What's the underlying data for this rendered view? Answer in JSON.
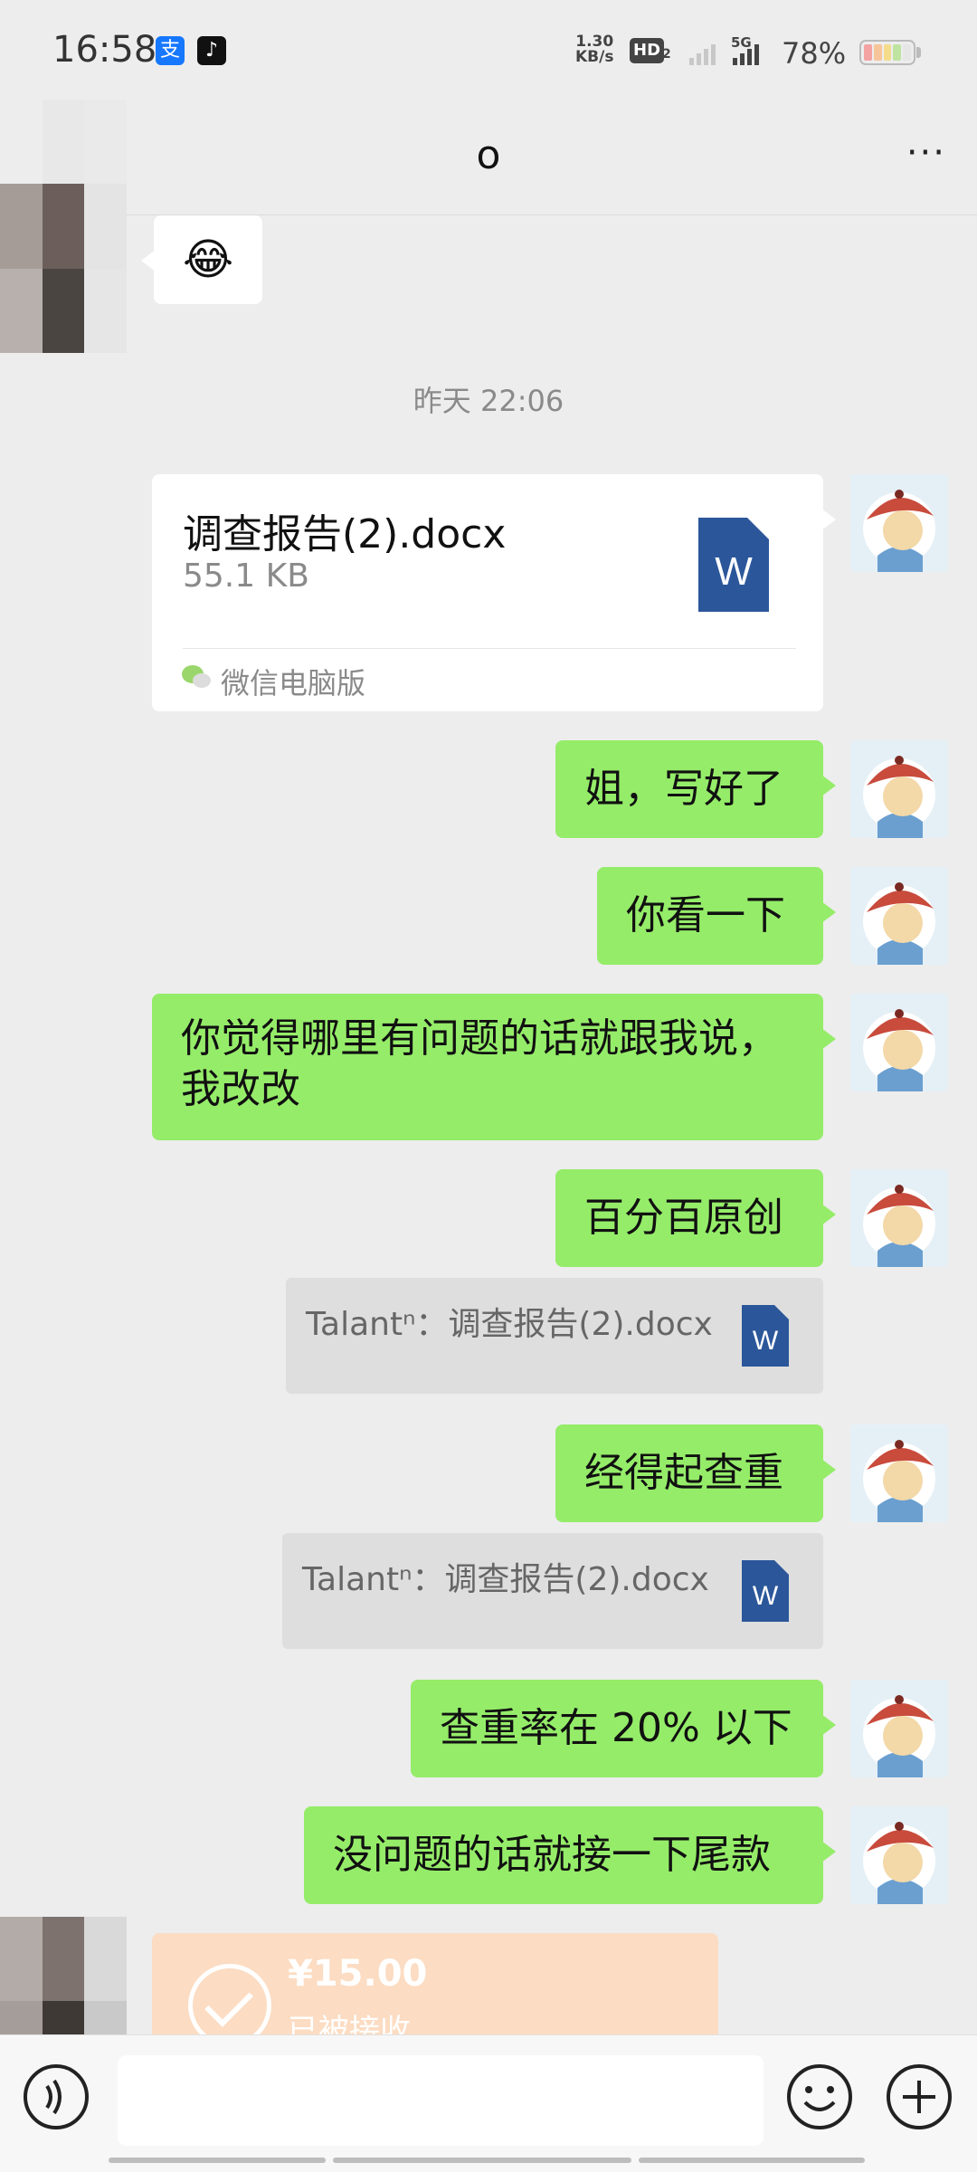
{
  "status_bar": {
    "time": "16:58",
    "net_speed_value": "1.30",
    "net_speed_unit": "KB/s",
    "hd_label": "HD",
    "hd_sub": "2",
    "network_type": "5G",
    "battery_percent": "78%",
    "battery_level": 0.78
  },
  "header": {
    "title": "o",
    "more_label": "···"
  },
  "messages": {
    "emoji_text": "😂",
    "timestamp": "昨天 22:06",
    "file_card": {
      "name": "调查报告(2).docx",
      "size": "55.1 KB",
      "source": "微信电脑版",
      "icon_letter": "W"
    },
    "msg1": "姐，写好了",
    "msg2": "你看一下",
    "msg3": "你觉得哪里有问题的话就跟我说，我改改",
    "msg4": "百分百原创",
    "quote1": "Talantⁿ：调查报告(2).docx",
    "quote1_icon": "W",
    "msg5": "经得起查重",
    "quote2": "Talantⁿ：调查报告(2).docx",
    "quote2_icon": "W",
    "msg6": "查重率在 20% 以下",
    "msg7": "没问题的话就接一下尾款",
    "transfer": {
      "amount": "¥15.00",
      "status": "已被接收"
    }
  },
  "input_bar": {
    "placeholder": ""
  },
  "colors": {
    "green_bubble": "#95ec69",
    "background": "#ededed",
    "word_blue": "#2b579a",
    "transfer_bg": "#fcdcc2"
  },
  "icons": [
    "alipay-icon",
    "tiktok-icon",
    "back-arrow-icon",
    "more-icon",
    "word-file-icon",
    "wechat-icon",
    "voice-icon",
    "emoji-icon",
    "plus-icon"
  ]
}
